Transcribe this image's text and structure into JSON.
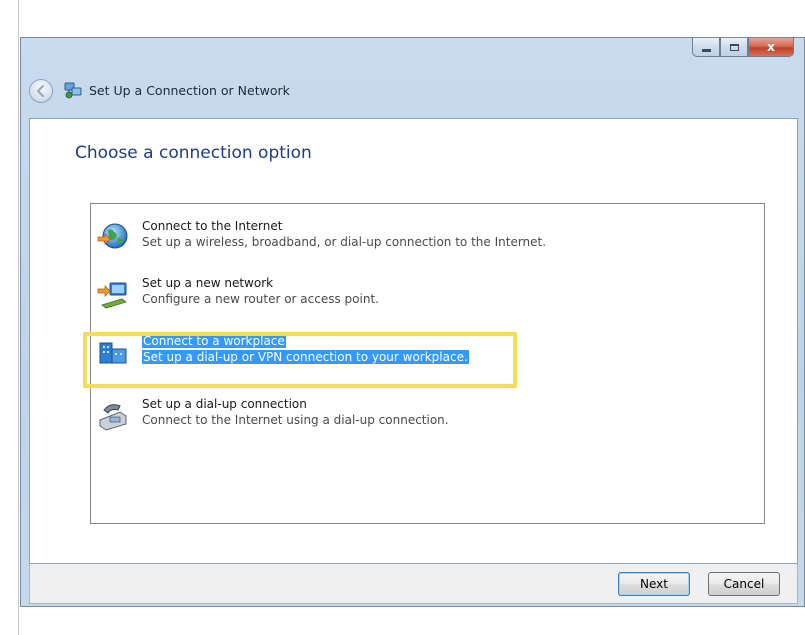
{
  "window": {
    "title": "Set Up a Connection or Network",
    "caption_buttons": {
      "close": "x"
    }
  },
  "main": {
    "heading": "Choose a connection option",
    "options": [
      {
        "title": "Connect to the Internet",
        "description": "Set up a wireless, broadband, or dial-up connection to the Internet.",
        "icon": "globe-icon",
        "selected": false
      },
      {
        "title": "Set up a new network",
        "description": "Configure a new router or access point.",
        "icon": "router-icon",
        "selected": false
      },
      {
        "title": "Connect to a workplace",
        "description": "Set up a dial-up or VPN connection to your workplace.",
        "icon": "workplace-icon",
        "selected": true
      },
      {
        "title": "Set up a dial-up connection",
        "description": "Connect to the Internet using a dial-up connection.",
        "icon": "phone-icon",
        "selected": false
      }
    ]
  },
  "footer": {
    "next_label": "Next",
    "cancel_label": "Cancel"
  },
  "colors": {
    "heading": "#1f3c8a",
    "selection": "#3399ff",
    "highlight_frame": "#f5dd5a"
  }
}
